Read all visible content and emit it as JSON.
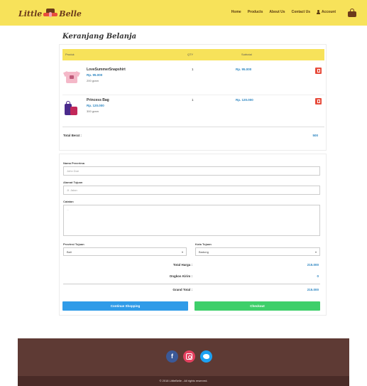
{
  "brand": {
    "left": "Little",
    "right": "Belle"
  },
  "nav": {
    "items": [
      "Home",
      "Products",
      "About Us",
      "Contact Us"
    ],
    "account": "Account"
  },
  "page_title": "Keranjang Belanja",
  "cart": {
    "headers": {
      "product": "Produk",
      "qty": "QTY",
      "subtotal": "Subtotal"
    },
    "items": [
      {
        "name": "LoveSummerSnapshirt",
        "price": "Rp. 95.000",
        "weight": "200 gram",
        "qty": "1",
        "subtotal": "Rp. 95.000",
        "image": "tshirt-image"
      },
      {
        "name": "Princess Bag",
        "price": "Rp. 120.000",
        "weight": "300 gram",
        "qty": "1",
        "subtotal": "Rp. 120.000",
        "image": "bag-image"
      }
    ],
    "total_label": "Total Berat :",
    "total_value": "500"
  },
  "form": {
    "name_label": "Nama Penerima",
    "name_placeholder": "John Doe",
    "address_label": "Alamat Tujuan",
    "address_placeholder": "Jl. Jalan",
    "notes_label": "Catatan",
    "notes_placeholder": "...",
    "province_label": "Provinsi Tujuan",
    "province_value": "Bali",
    "city_label": "Kota Tujuan",
    "city_value": "Badung"
  },
  "summary": {
    "total_harga_label": "Total Harga :",
    "total_harga_value": "215.000",
    "ongkir_label": "Ongkos Kirim :",
    "ongkir_value": "0",
    "grand_total_label": "Grand Total :",
    "grand_total_value": "215.000"
  },
  "buttons": {
    "continue": "Continue Shopping",
    "checkout": "Checkout"
  },
  "footer": {
    "social": [
      "facebook-icon",
      "instagram-icon",
      "twitter-icon"
    ],
    "copyright": "© 2018 LittleBelle - All rights reserved."
  },
  "colors": {
    "navbar": "#f7e25a",
    "footer": "#5e3a34",
    "price_blue": "#2e86c1",
    "continue_btn": "#2f9be8",
    "checkout_btn": "#3ecf6a",
    "remove_btn": "#e74c3c"
  }
}
